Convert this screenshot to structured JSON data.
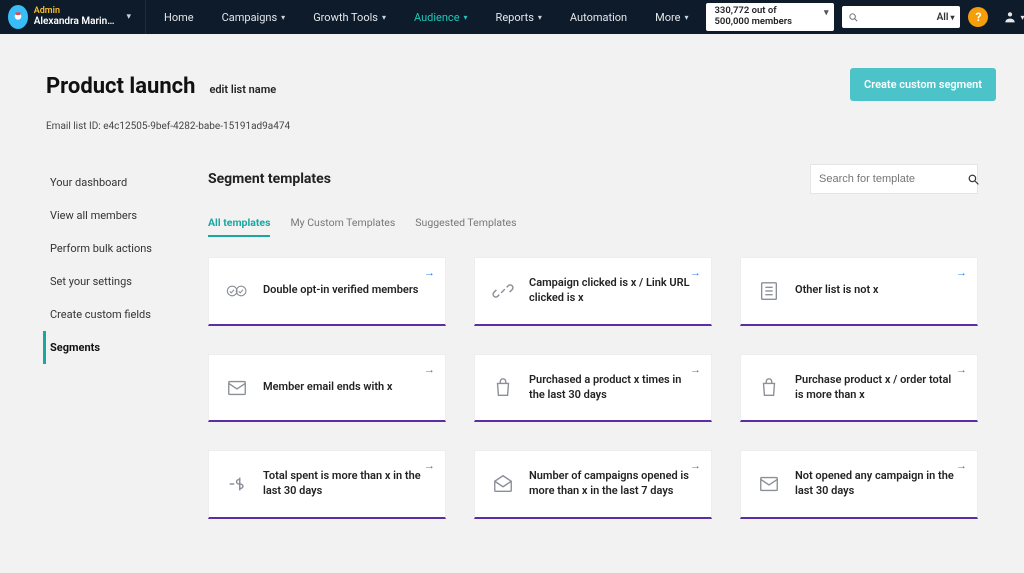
{
  "header": {
    "admin_label": "Admin",
    "user_name": "Alexandra Marin…",
    "nav": [
      {
        "label": "Home",
        "chev": false,
        "active": false
      },
      {
        "label": "Campaigns",
        "chev": true,
        "active": false
      },
      {
        "label": "Growth Tools",
        "chev": true,
        "active": false
      },
      {
        "label": "Audience",
        "chev": true,
        "active": true
      },
      {
        "label": "Reports",
        "chev": true,
        "active": false
      },
      {
        "label": "Automation",
        "chev": false,
        "active": false
      },
      {
        "label": "More",
        "chev": true,
        "active": false
      }
    ],
    "member_counter_line1": "330,772 out of",
    "member_counter_line2": "500,000 members",
    "search_all_label": "All",
    "help_glyph": "?",
    "search_placeholder": ""
  },
  "page": {
    "title": "Product launch",
    "edit_list_label": "edit list name",
    "list_id_label": "Email list ID: e4c12505-9bef-4282-babe-15191ad9a474",
    "create_segment_button": "Create custom segment"
  },
  "sidebar": {
    "items": [
      {
        "label": "Your dashboard",
        "active": false
      },
      {
        "label": "View all members",
        "active": false
      },
      {
        "label": "Perform bulk actions",
        "active": false
      },
      {
        "label": "Set your settings",
        "active": false
      },
      {
        "label": "Create custom fields",
        "active": false
      },
      {
        "label": "Segments",
        "active": true
      }
    ]
  },
  "segments": {
    "heading": "Segment templates",
    "search_placeholder": "Search for template",
    "tabs": [
      {
        "label": "All templates",
        "active": true
      },
      {
        "label": "My Custom Templates",
        "active": false
      },
      {
        "label": "Suggested Templates",
        "active": false
      }
    ],
    "cards": [
      {
        "label": "Double opt-in verified members",
        "icon": "double-check-icon"
      },
      {
        "label": "Campaign clicked is x / Link URL clicked is x",
        "icon": "link-icon"
      },
      {
        "label": "Other list is not x",
        "icon": "list-doc-icon"
      },
      {
        "label": "Member email ends with x",
        "icon": "envelope-icon"
      },
      {
        "label": "Purchased a product x times in the last 30 days",
        "icon": "shopping-bag-icon"
      },
      {
        "label": "Purchase product x / order total is more than x",
        "icon": "shopping-bag-icon"
      },
      {
        "label": "Total spent is more than x in the last 30 days",
        "icon": "dollar-icon"
      },
      {
        "label": "Number of campaigns opened is more than x in the last 7 days",
        "icon": "open-envelope-icon"
      },
      {
        "label": "Not opened any campaign in the last 30 days",
        "icon": "envelope-icon"
      }
    ]
  }
}
